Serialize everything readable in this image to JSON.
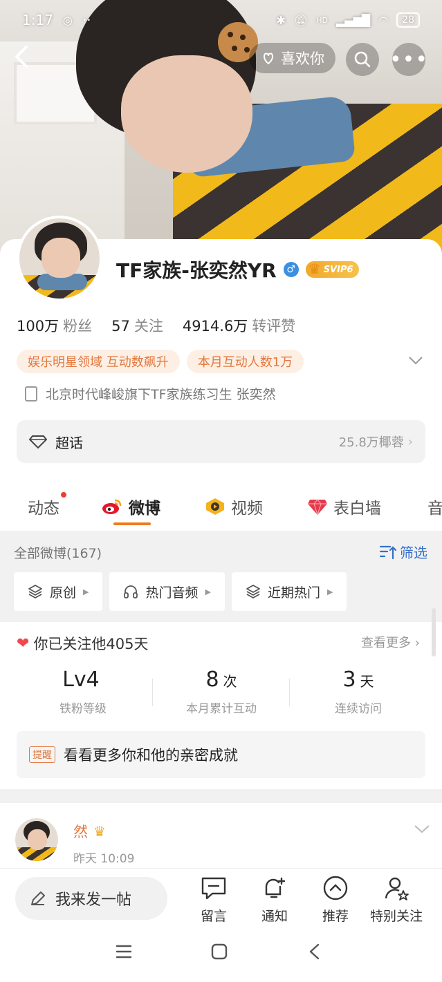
{
  "status_bar": {
    "time": "1:17",
    "extra": "··",
    "network": "HD",
    "battery": "28"
  },
  "top_nav": {
    "like_label": "喜欢你"
  },
  "profile": {
    "name": "TF家族-张奕然YR",
    "vip_badge": "SVIP6",
    "stats": [
      {
        "value": "100万",
        "label": "粉丝"
      },
      {
        "value": "57",
        "label": "关注"
      },
      {
        "value": "4914.6万",
        "label": "转评赞"
      }
    ],
    "tags": [
      "娱乐明星领域 互动数飙升",
      "本月互动人数1万"
    ],
    "bio": "北京时代峰峻旗下TF家族练习生 张奕然",
    "super_topic": {
      "label": "超话",
      "count": "25.8万椰蓉"
    }
  },
  "tabs": [
    {
      "label": "动态"
    },
    {
      "label": "微博"
    },
    {
      "label": "视频"
    },
    {
      "label": "表白墙"
    },
    {
      "label": "音"
    }
  ],
  "feed": {
    "header": "全部微博(167)",
    "filter_label": "筛选",
    "chips": [
      "原创",
      "热门音频",
      "近期热门"
    ]
  },
  "fan_card": {
    "title": "你已关注他405天",
    "more": "查看更多",
    "stats": [
      {
        "value": "Lv4",
        "unit": "",
        "label": "铁粉等级"
      },
      {
        "value": "8",
        "unit": "次",
        "label": "本月累计互动"
      },
      {
        "value": "3",
        "unit": "天",
        "label": "连续访问"
      }
    ],
    "remind_badge": "提醒",
    "remind_text": "看看更多你和他的亲密成就"
  },
  "post": {
    "author": "然",
    "time": "昨天 10:09"
  },
  "bottom_bar": {
    "compose": "我来发一帖",
    "items": [
      "留言",
      "通知",
      "推荐",
      "特别关注"
    ]
  },
  "colors": {
    "accent_orange": "#f07b1f",
    "link_blue": "#3570c9",
    "tag_text": "#e3783f"
  }
}
